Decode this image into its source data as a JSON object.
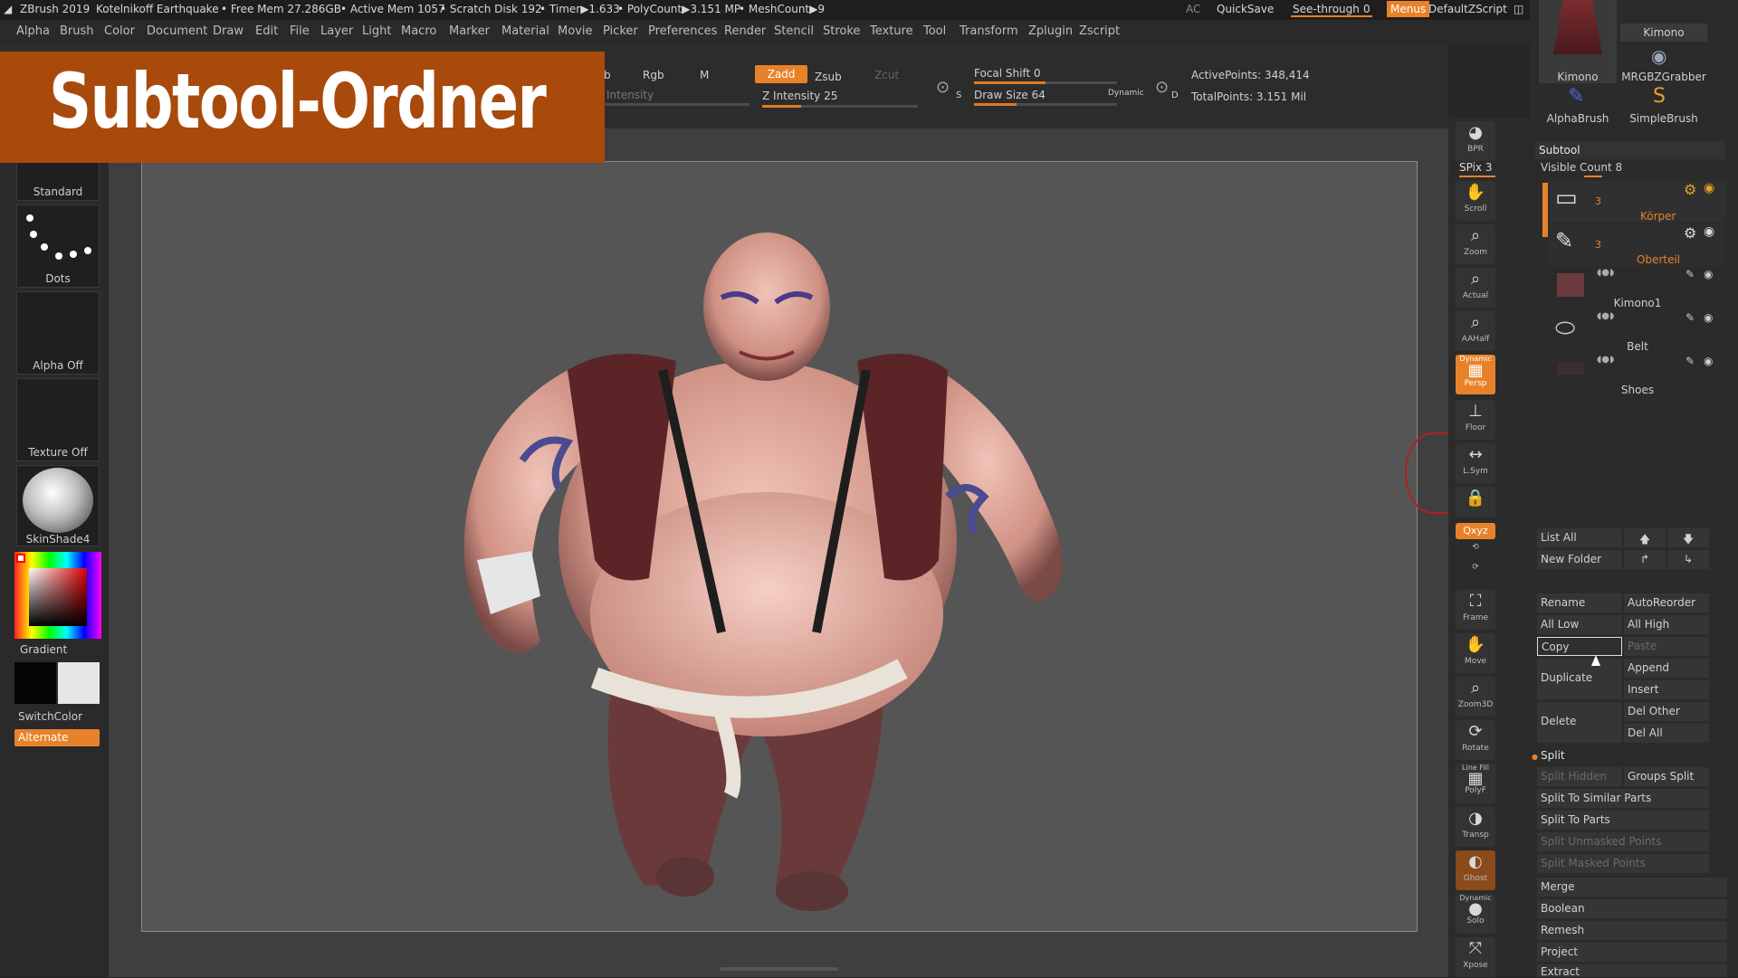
{
  "titlebar": {
    "app": "ZBrush 2019",
    "project": "Kotelnikoff Earthquake",
    "free_mem": "• Free Mem 27.286GB",
    "active_mem": "• Active Mem 1057",
    "scratch": "• Scratch Disk 192",
    "timer": "• Timer▶1.633",
    "polycount": "• PolyCount▶3.151 MP",
    "meshcount": "• MeshCount▶9",
    "ac": "AC",
    "quicksave": "QuickSave",
    "seethrough": "See-through",
    "seethrough_value": "0",
    "menus": "Menus",
    "script": "DefaultZScript"
  },
  "menubar": [
    "Alpha",
    "Brush",
    "Color",
    "Document",
    "Draw",
    "Edit",
    "File",
    "Layer",
    "Light",
    "Macro",
    "Marker",
    "Material",
    "Movie",
    "Picker",
    "Preferences",
    "Render",
    "Stencil",
    "Stroke",
    "Texture",
    "Tool",
    "Transform",
    "Zplugin",
    "Zscript"
  ],
  "overlay_title": "Subtool-Ordner",
  "topshelf": {
    "b": "b",
    "rgb": "Rgb",
    "m": "M",
    "zadd": "Zadd",
    "zsub": "Zsub",
    "zcut": "Zcut",
    "intensity": "Intensity",
    "z_intensity": "Z Intensity 25",
    "focal_shift": "Focal Shift 0",
    "draw_size": "Draw Size 64",
    "dynamic": "Dynamic",
    "active_points": "ActivePoints: 348,414",
    "total_points": "TotalPoints: 3.151 Mil",
    "z_intensity_level": 0.25,
    "focal_shift_level": 0.5,
    "draw_size_level": 0.3
  },
  "leftshelf": {
    "standard": "Standard",
    "dots": "Dots",
    "alpha_off": "Alpha Off",
    "texture_off": "Texture Off",
    "material": "SkinShade4",
    "gradient": "Gradient",
    "switchcolor": "SwitchColor",
    "alternate": "Alternate"
  },
  "rightshelf": {
    "bpr": "BPR",
    "spix": "SPix 3",
    "scroll": "Scroll",
    "zoom": "Zoom",
    "actual": "Actual",
    "aahalf": "AAHalf",
    "dynamic": "Dynamic",
    "persp": "Persp",
    "floor": "Floor",
    "lsym": "L.Sym",
    "xyz": "Qxyz",
    "frame": "Frame",
    "move": "Move",
    "zoom3d": "Zoom3D",
    "rotate": "Rotate",
    "linefill": "Line Fill",
    "polyf": "PolyF",
    "transp": "Transp",
    "ghost": "Ghost",
    "dynamic2": "Dynamic",
    "solo": "Solo",
    "xpose": "Xpose"
  },
  "tray_top": {
    "kimono_top": "Kimono",
    "kimono": "Kimono",
    "mrgbzgrabber": "MRGBZGrabber",
    "alphabrush": "AlphaBrush",
    "simplebrush": "SimpleBrush"
  },
  "subtool": {
    "header": "Subtool",
    "visible_count": "Visible Count 8",
    "folders": [
      {
        "count": "3",
        "name": "Körper"
      },
      {
        "count": "3",
        "name": "Oberteil"
      }
    ],
    "items": [
      "Kimono1",
      "Belt",
      "Shoes"
    ],
    "list_all": "List All",
    "new_folder": "New Folder",
    "rename": "Rename",
    "autoreorder": "AutoReorder",
    "all_low": "All Low",
    "all_high": "All High",
    "copy": "Copy",
    "paste": "Paste",
    "duplicate": "Duplicate",
    "append": "Append",
    "insert": "Insert",
    "delete": "Delete",
    "del_other": "Del Other",
    "del_all": "Del All",
    "split": "Split",
    "split_hidden": "Split Hidden",
    "groups_split": "Groups Split",
    "split_similar": "Split To Similar Parts",
    "split_parts": "Split To Parts",
    "split_unmasked": "Split Unmasked Points",
    "split_masked": "Split Masked Points",
    "merge": "Merge",
    "boolean": "Boolean",
    "remesh": "Remesh",
    "project": "Project",
    "extract": "Extract"
  },
  "colors": {
    "accent": "#e8822a",
    "overlay": "#a94a0d",
    "panel": "#2b2b2b"
  }
}
